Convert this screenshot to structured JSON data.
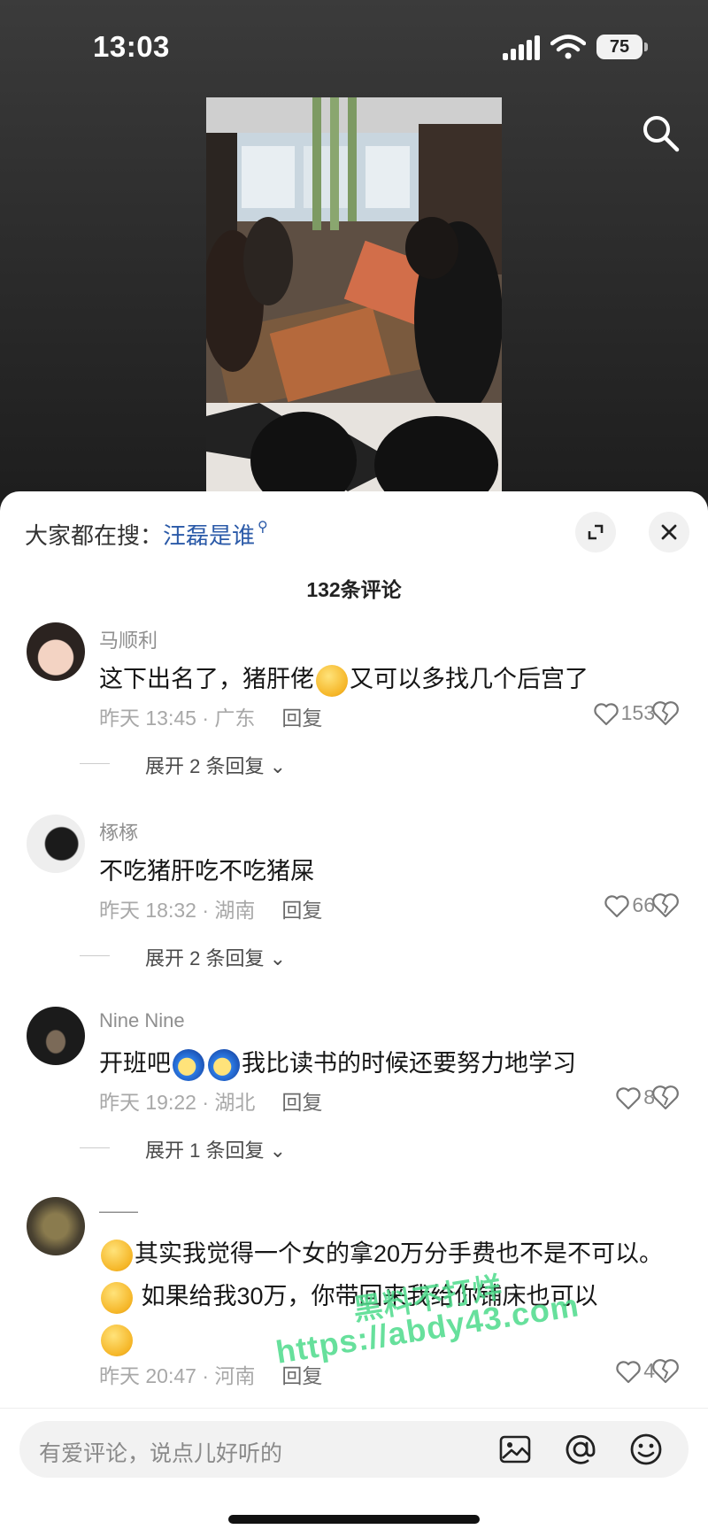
{
  "status_bar": {
    "time": "13:03",
    "battery": "75"
  },
  "hot_search": {
    "label": "大家都在搜：",
    "query": "汪磊是谁"
  },
  "comment_count": "132条评论",
  "comments": [
    {
      "username": "马顺利",
      "text_before_emoji": "这下出名了，猪肝佬",
      "text_after_emoji": "又可以多找几个后宫了",
      "time_location": "昨天 13:45 · 广东",
      "reply_label": "回复",
      "likes": "153",
      "more_replies": "展开 2 条回复"
    },
    {
      "username": "椓椓",
      "text": "不吃猪肝吃不吃猪屎",
      "time_location": "昨天 18:32 · 湖南",
      "reply_label": "回复",
      "likes": "66",
      "more_replies": "展开 2 条回复"
    },
    {
      "username": "Nine Nine",
      "text_before_emoji": "开班吧",
      "text_after_emoji": "我比读书的时候还要努力地学习",
      "time_location": "昨天 19:22 · 湖北",
      "reply_label": "回复",
      "likes": "8",
      "more_replies": "展开 1 条回复"
    },
    {
      "username": "——",
      "text_part1": "其实我觉得一个女的拿20万分手费也不是不可以。",
      "text_part2": "如果给我30万，你带回来我给你铺床也可以",
      "time_location": "昨天 20:47 · 河南",
      "reply_label": "回复",
      "likes": "4"
    }
  ],
  "input": {
    "placeholder": "有爱评论，说点儿好听的"
  },
  "watermark": {
    "line1": "黑料不打烊",
    "line2": "https://abdy43.com"
  },
  "icons": [
    "search-icon",
    "expand-icon",
    "close-icon",
    "heart-icon",
    "broken-heart-icon",
    "image-icon",
    "at-icon",
    "smiley-icon"
  ],
  "colors": {
    "link_blue": "#2b5aa8",
    "watermark_green": "#4ddb8b"
  }
}
